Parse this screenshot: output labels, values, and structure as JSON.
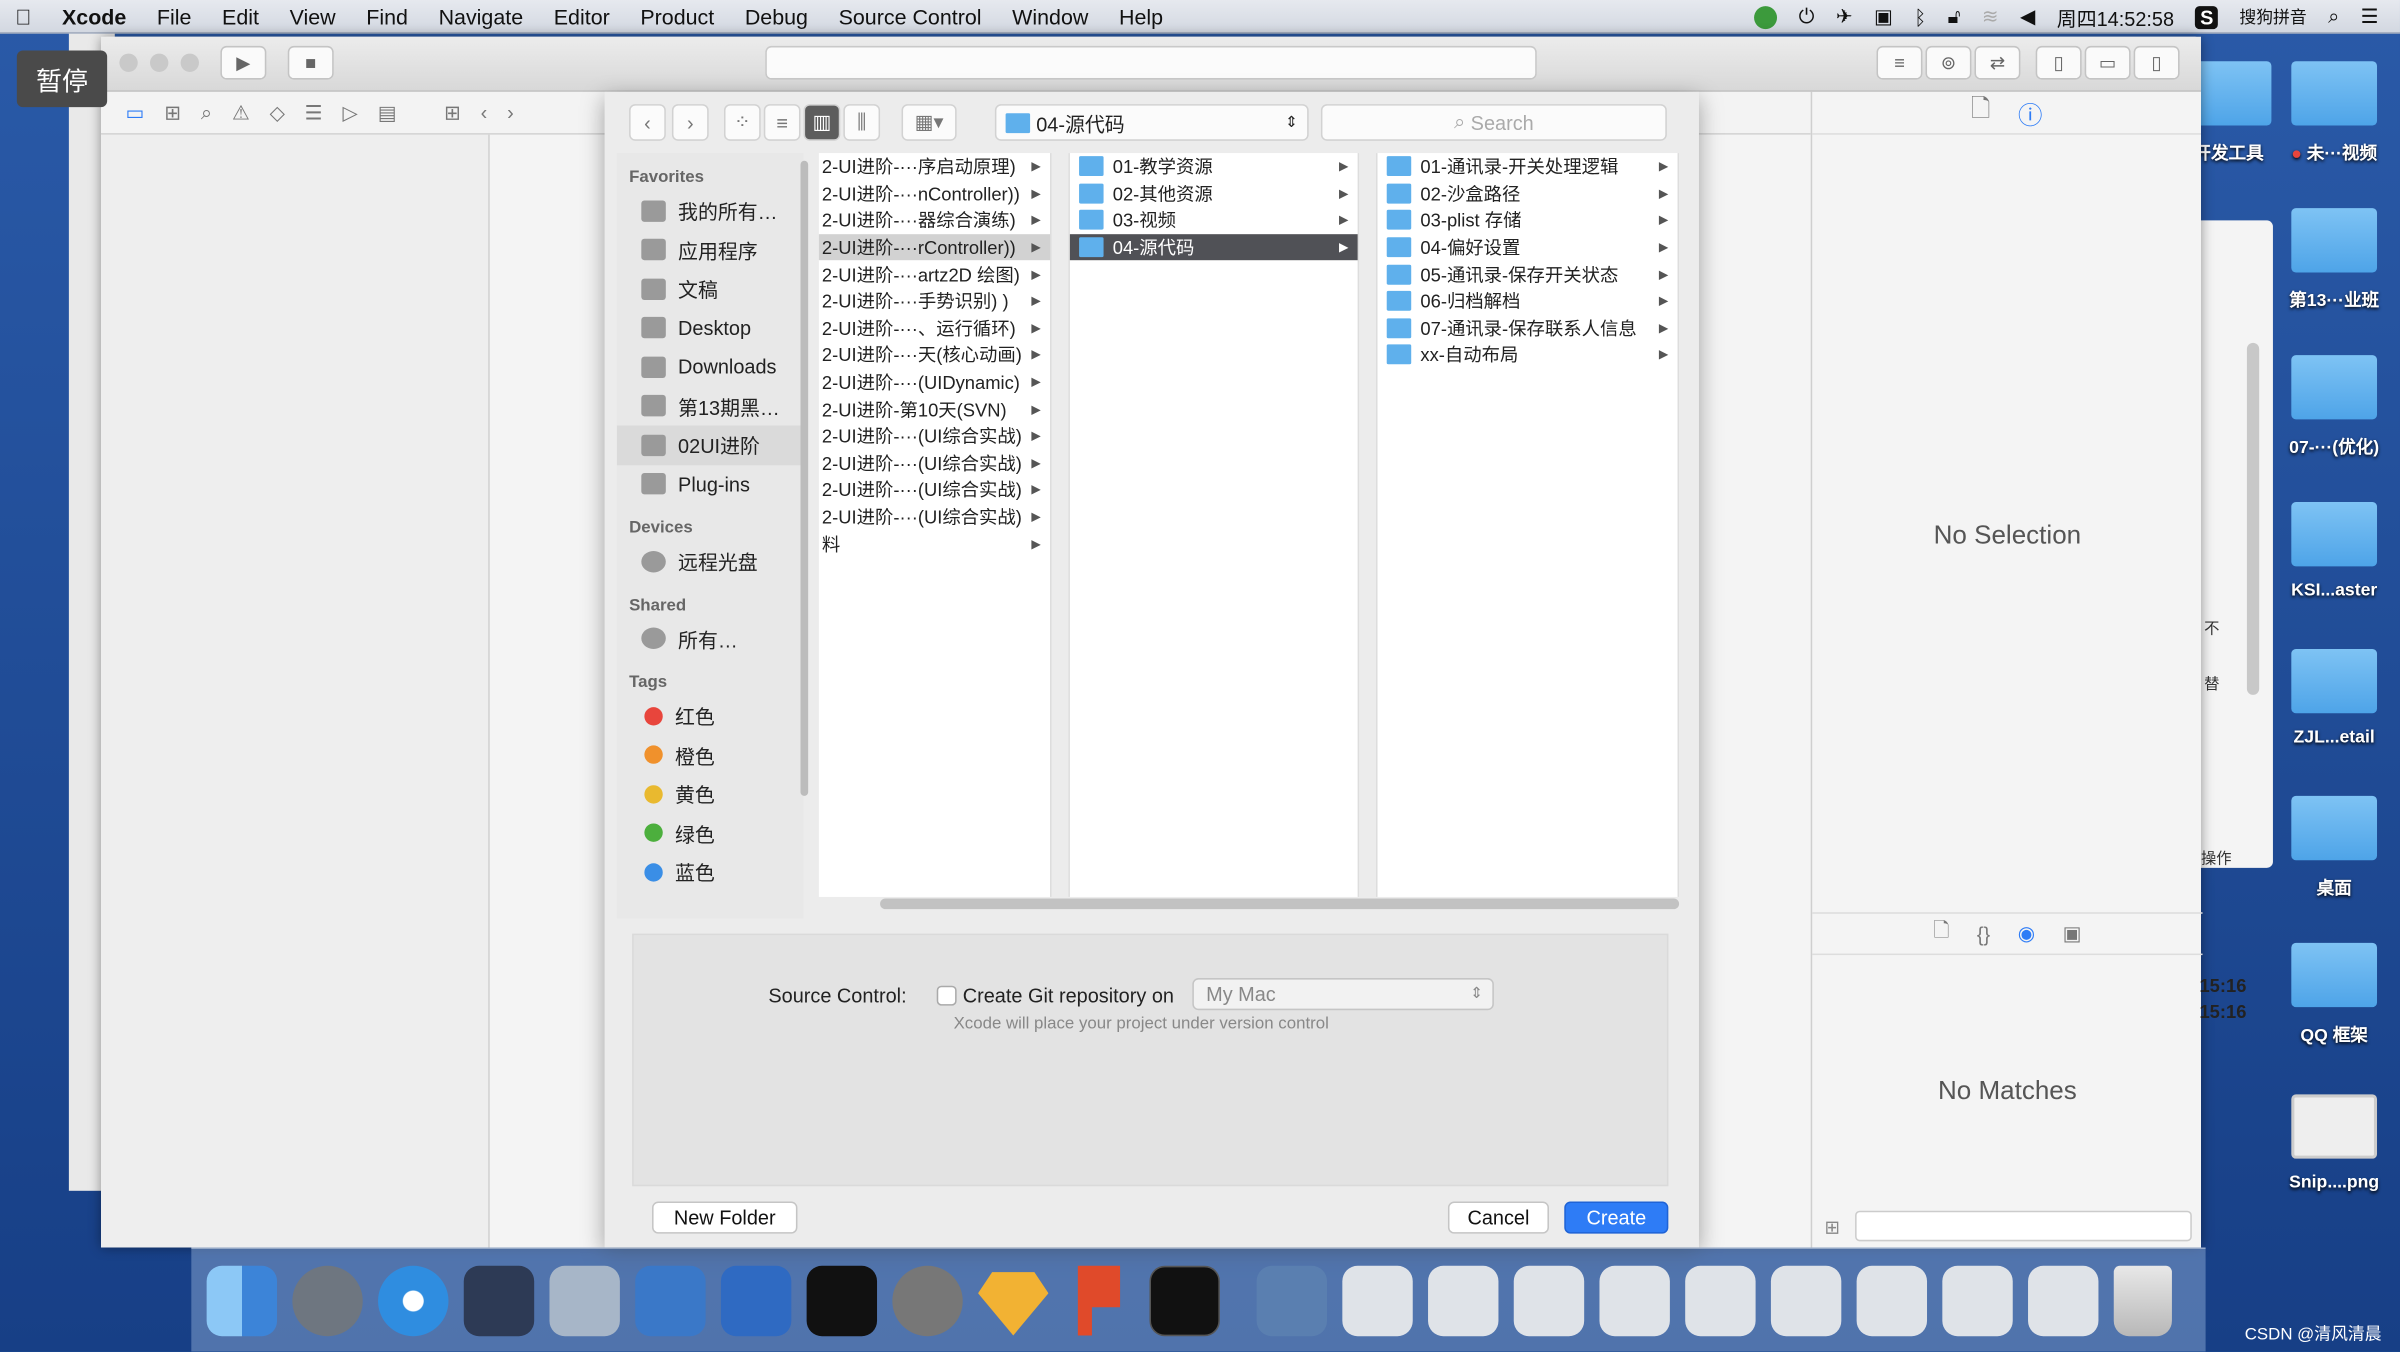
{
  "menubar": {
    "app": "Xcode",
    "items": [
      "File",
      "Edit",
      "View",
      "Find",
      "Navigate",
      "Editor",
      "Product",
      "Debug",
      "Source Control",
      "Window",
      "Help"
    ],
    "clock": "周四14:52:58",
    "ime": "搜狗拼音"
  },
  "overlay": {
    "pause": "暂停"
  },
  "sheet": {
    "path": "04-源代码",
    "search_placeholder": "Search",
    "sidebar": {
      "favorites_header": "Favorites",
      "favorites": [
        "我的所有…",
        "应用程序",
        "文稿",
        "Desktop",
        "Downloads",
        "第13期黑…",
        "02UI进阶",
        "Plug-ins"
      ],
      "selected": "02UI进阶",
      "devices_header": "Devices",
      "devices": [
        "远程光盘"
      ],
      "shared_header": "Shared",
      "shared": [
        "所有…"
      ],
      "tags_header": "Tags",
      "tags": [
        {
          "label": "红色",
          "color": "#e8453c"
        },
        {
          "label": "橙色",
          "color": "#f0912c"
        },
        {
          "label": "黄色",
          "color": "#e9b92f"
        },
        {
          "label": "绿色",
          "color": "#4caf3d"
        },
        {
          "label": "蓝色",
          "color": "#3a8ee6"
        }
      ]
    },
    "col1": [
      "2-UI进阶-···序启动原理)",
      "2-UI进阶-···nController))",
      "2-UI进阶-···器综合演练)",
      "2-UI进阶-···rController))",
      "2-UI进阶-···artz2D 绘图)",
      "2-UI进阶-···手势识别) )",
      "2-UI进阶-···、运行循环)",
      "2-UI进阶-···天(核心动画)",
      "2-UI进阶-···(UIDynamic)",
      "2-UI进阶-第10天(SVN)",
      "2-UI进阶-···(UI综合实战)",
      "2-UI进阶-···(UI综合实战)",
      "2-UI进阶-···(UI综合实战)",
      "2-UI进阶-···(UI综合实战)",
      "料"
    ],
    "col2": [
      "01-教学资源",
      "02-其他资源",
      "03-视频",
      "04-源代码"
    ],
    "col3": [
      "01-通讯录-开关处理逻辑",
      "02-沙盒路径",
      "03-plist 存储",
      "04-偏好设置",
      "05-通讯录-保存开关状态",
      "06-归档解档",
      "07-通讯录-保存联系人信息",
      "xx-自动布局"
    ],
    "source_control_label": "Source Control:",
    "git_checkbox_label": "Create Git repository on",
    "git_checked": false,
    "git_target": "My Mac",
    "git_hint": "Xcode will place your project under version control",
    "new_folder": "New Folder",
    "cancel": "Cancel",
    "create": "Create"
  },
  "inspector": {
    "no_selection": "No Selection",
    "no_matches": "No Matches"
  },
  "behind_window": {
    "times": [
      "15:16",
      "15:16"
    ],
    "snippets": [
      "不",
      "替",
      "操作"
    ]
  },
  "desktop": [
    "开发工具",
    "未···视频",
    "第13···业班",
    "07-···(优化)",
    "KSI...aster",
    "ZJL...etail",
    "桌面",
    "QQ 框架",
    "Snip....png"
  ],
  "watermark": "CSDN @清风清晨",
  "colors": {
    "accent": "#2e7cf6",
    "desktop": "#1a4a92",
    "folder": "#5fb0ec"
  }
}
